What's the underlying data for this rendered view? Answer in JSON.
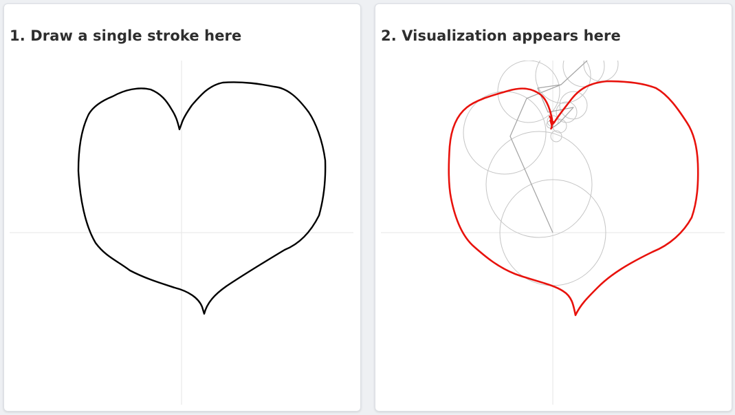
{
  "draw_panel": {
    "title": "1. Draw a single stroke here"
  },
  "viz_panel": {
    "title": "2. Visualization appears here"
  },
  "colors": {
    "stroke": "#000000",
    "trace": "#e8120c",
    "epicycle": "#b8b8b8",
    "axis": "#e6e6e6"
  }
}
